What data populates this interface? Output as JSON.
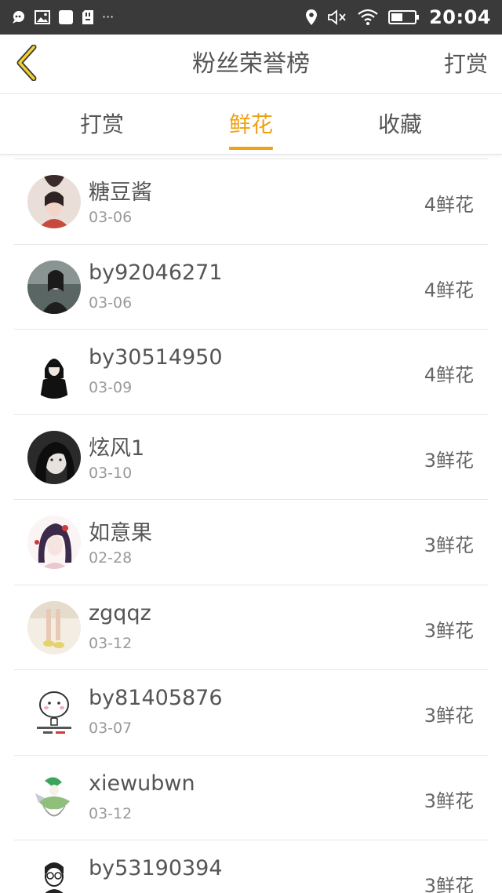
{
  "status_bar": {
    "time": "20:04",
    "left_icons": [
      "chat-bubble-icon",
      "image-icon",
      "square-app-icon",
      "sd-card-icon"
    ],
    "overflow_dots": "···",
    "right_icons": [
      "location-pin-icon",
      "mute-icon",
      "wifi-icon",
      "battery-icon"
    ]
  },
  "header": {
    "title": "粉丝荣誉榜",
    "action_label": "打赏",
    "back_icon": "chevron-left-icon",
    "accent_color": "#f0a015"
  },
  "tabs": [
    {
      "label": "打赏",
      "active": false
    },
    {
      "label": "鲜花",
      "active": true
    },
    {
      "label": "收藏",
      "active": false
    }
  ],
  "fans": [
    {
      "name": "糖豆酱",
      "date": "03-06",
      "count": "4鲜花"
    },
    {
      "name": "by92046271",
      "date": "03-06",
      "count": "4鲜花"
    },
    {
      "name": "by30514950",
      "date": "03-09",
      "count": "4鲜花"
    },
    {
      "name": "炫风1",
      "date": "03-10",
      "count": "3鲜花"
    },
    {
      "name": "如意果",
      "date": "02-28",
      "count": "3鲜花"
    },
    {
      "name": "zgqqz",
      "date": "03-12",
      "count": "3鲜花"
    },
    {
      "name": "by81405876",
      "date": "03-07",
      "count": "3鲜花"
    },
    {
      "name": "xiewubwn",
      "date": "03-12",
      "count": "3鲜花"
    },
    {
      "name": "by53190394",
      "date": "",
      "count": "3鲜花"
    }
  ]
}
